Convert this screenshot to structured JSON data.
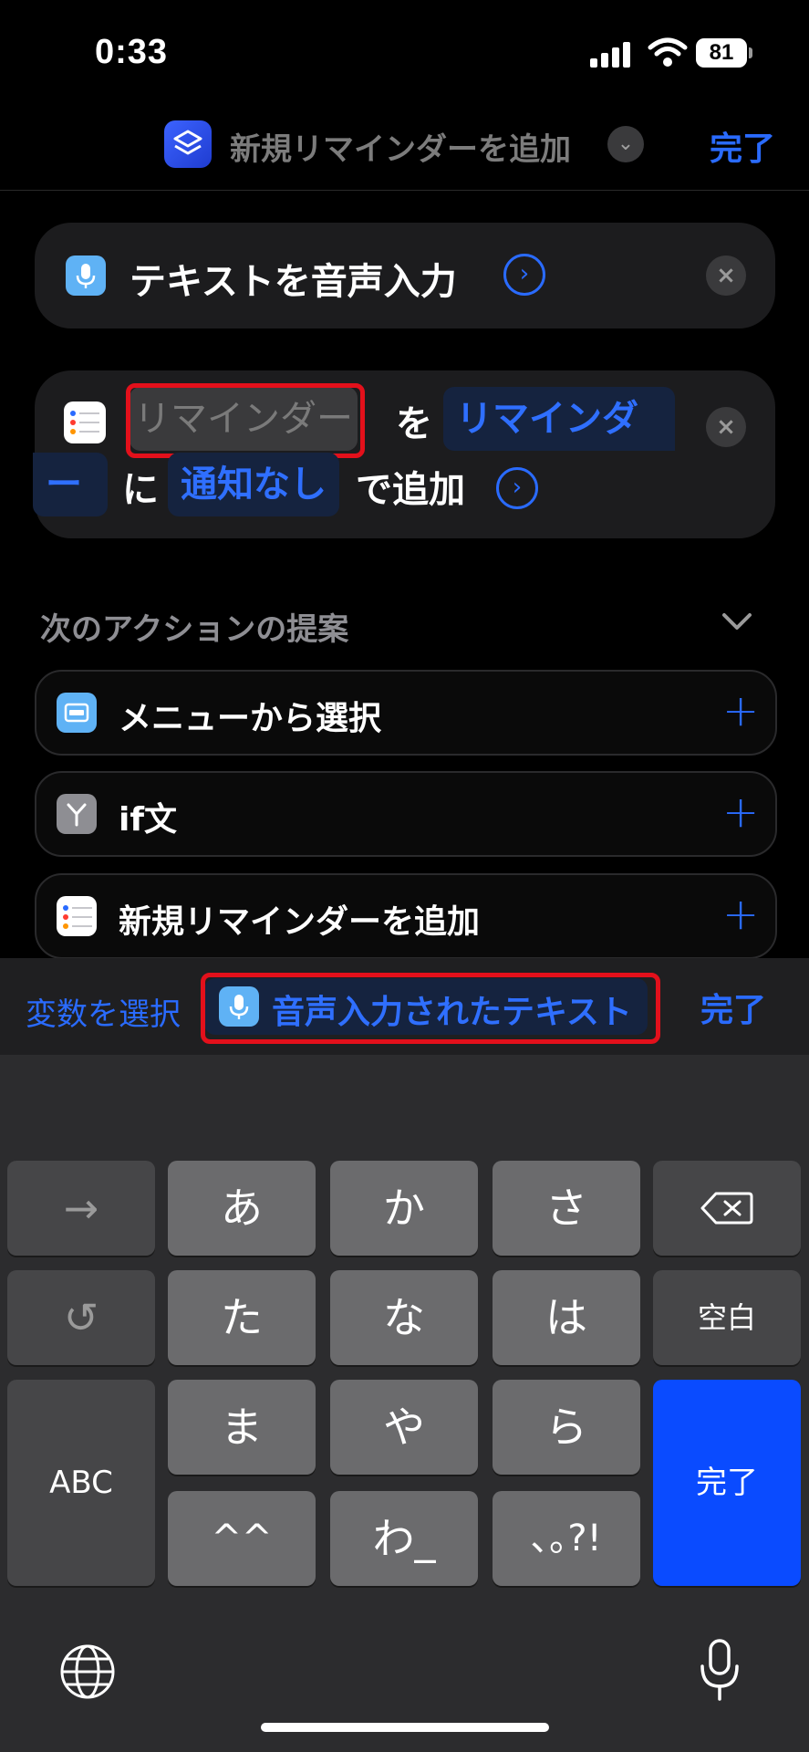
{
  "status_bar": {
    "time": "0:33",
    "battery": "81"
  },
  "header": {
    "title": "新規リマインダーを追加",
    "done": "完了"
  },
  "action_dictate": {
    "title": "テキストを音声入力"
  },
  "action_reminder": {
    "placeholder": "リマインダー",
    "particle_wo": "を",
    "list_token_part1": "リマインダ",
    "list_token_part2": "ー",
    "particle_ni": "に",
    "alert_token": "通知なし",
    "suffix": "で追加"
  },
  "suggestions": {
    "title": "次のアクションの提案",
    "items": [
      {
        "label": "メニューから選択",
        "icon": "menu-icon",
        "color": "#5fb2f5"
      },
      {
        "label": "if文",
        "icon": "branch-icon",
        "color": "#8e8e93"
      },
      {
        "label": "新規リマインダーを追加",
        "icon": "reminders-icon",
        "color": "#ffffff"
      }
    ]
  },
  "variable_bar": {
    "select_label": "変数を選択",
    "token_label": "音声入力されたテキスト",
    "done": "完了"
  },
  "keyboard": {
    "row1": [
      "→",
      "あ",
      "か",
      "さ"
    ],
    "row2": [
      "↺",
      "た",
      "な",
      "は",
      "空白"
    ],
    "row3": [
      "ま",
      "や",
      "ら"
    ],
    "row4": [
      "^^",
      "わ_",
      "､｡?!"
    ],
    "abc": "ABC",
    "done": "完了"
  },
  "colors": {
    "accent": "#2a6bff",
    "highlight": "#e3101b",
    "keyboard_done": "#0a4bff"
  }
}
